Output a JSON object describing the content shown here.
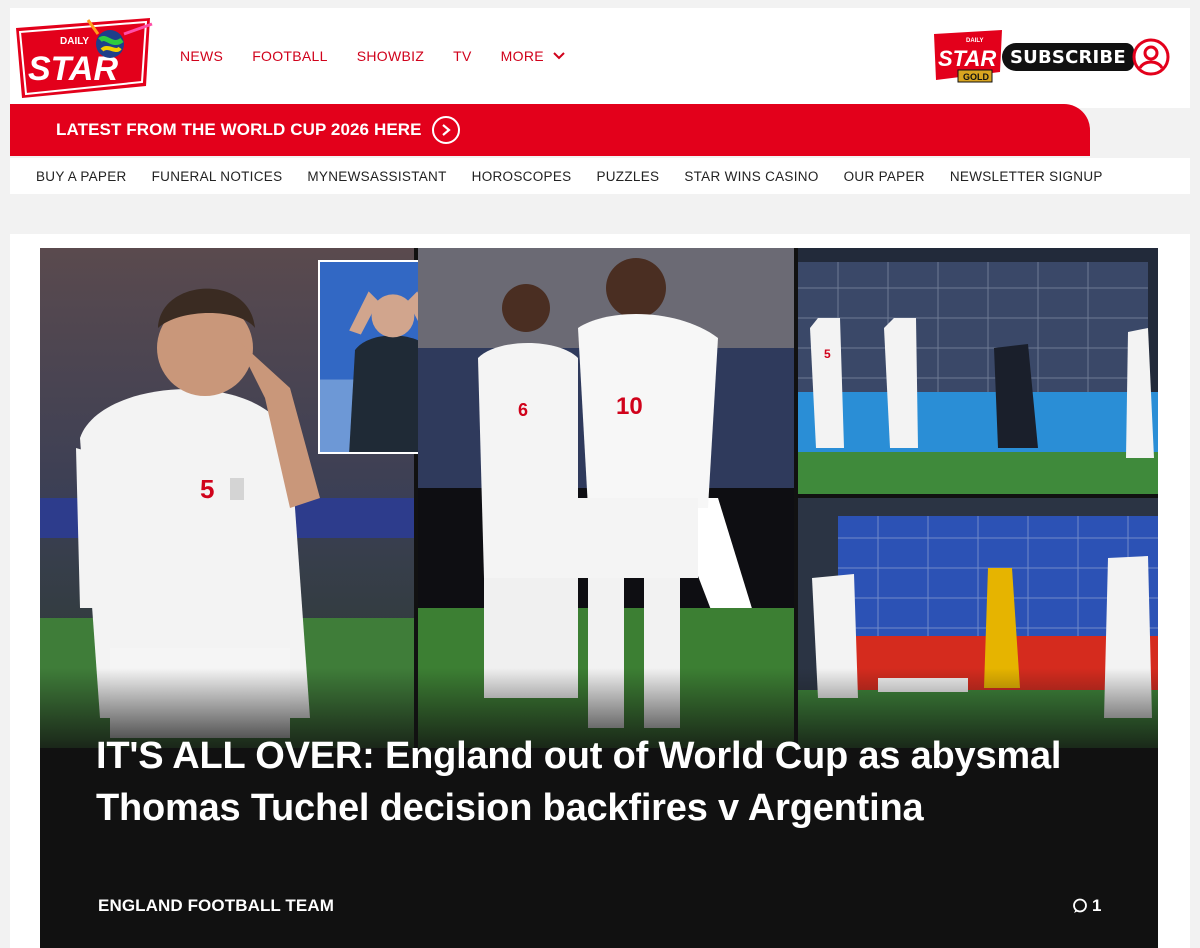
{
  "brand": {
    "logo_top": "DAILY",
    "logo_main": "STAR",
    "gold_top": "DAILY",
    "gold_main": "STAR",
    "gold_label": "GOLD",
    "subscribe_label": "SUBSCRIBE",
    "accent_color": "#e3001b"
  },
  "nav": {
    "items": [
      {
        "label": "NEWS"
      },
      {
        "label": "FOOTBALL"
      },
      {
        "label": "SHOWBIZ"
      },
      {
        "label": "TV"
      },
      {
        "label": "MORE"
      }
    ]
  },
  "banner": {
    "text": "LATEST FROM THE WORLD CUP 2026 HERE"
  },
  "subnav": {
    "items": [
      {
        "label": "BUY A PAPER"
      },
      {
        "label": "FUNERAL NOTICES"
      },
      {
        "label": "MYNEWSASSISTANT"
      },
      {
        "label": "HOROSCOPES"
      },
      {
        "label": "PUZZLES"
      },
      {
        "label": "STAR WINS CASINO"
      },
      {
        "label": "OUR PAPER"
      },
      {
        "label": "NEWSLETTER SIGNUP"
      }
    ]
  },
  "article": {
    "headline": "IT'S ALL OVER: England out of World Cup as abysmal Thomas Tuchel decision backfires v Argentina",
    "category": "ENGLAND FOOTBALL TEAM",
    "comment_count": "1",
    "shirt_numbers": {
      "player_left": "5",
      "player_mid_back": "6",
      "player_mid_front": "10",
      "goal_top": "5"
    }
  }
}
